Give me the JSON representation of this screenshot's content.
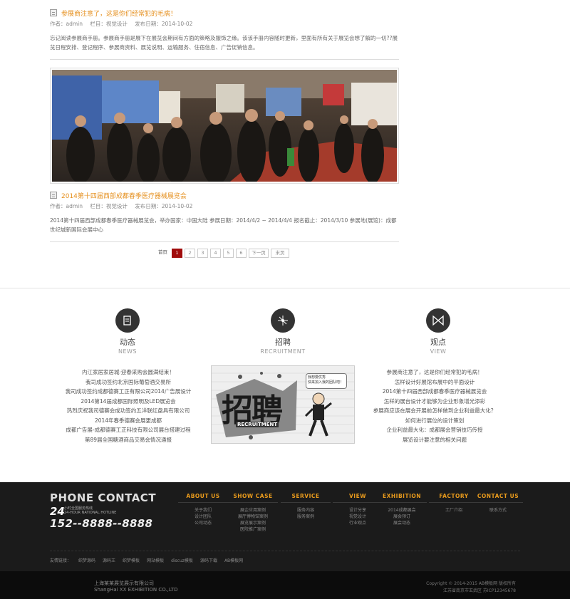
{
  "articles": [
    {
      "title": "参展商注意了，这是你们经常犯的毛病！",
      "author": "作者：admin",
      "column": "栏目：视觉设计",
      "date": "发布日期：2014-10-02",
      "summary": "忘记阅读参展商手册。参展商手册是展下在展览会期间有方面的策略及服饰之缘。该该手册内容随时更新，里面有所有关于展览会想了解的一切??展览日程安排、登记程序、参展商资料、展览说明、运输服务、住宿信息、广告促销信息。"
    },
    {
      "title": "2014第十四届西部成都春季医疗器械展览会",
      "author": "作者：admin",
      "column": "栏目：视觉设计",
      "date": "发布日期：2014-10-02",
      "summary": "2014第十四届西部成都春季医疗器械展览会，举办国家：中国大陆 参展日期：2014/4/2 ~ 2014/4/4 报名截止：2014/3/10 参展地(展馆)：成都世纪城新国际会展中心"
    }
  ],
  "pager": {
    "first": "首页",
    "pages": [
      "1",
      "2",
      "3",
      "4",
      "5",
      "6"
    ],
    "next": "下一页",
    "last": "末页"
  },
  "columns": {
    "news": {
      "cn": "动态",
      "en": "NEWS",
      "icon": "document-icon"
    },
    "recruit": {
      "cn": "招聘",
      "en": "RECRUITMENT",
      "icon": "sparkle-icon"
    },
    "view": {
      "cn": "观点",
      "en": "VIEW",
      "icon": "bowtie-icon"
    }
  },
  "news_links": [
    "内江家居家居城·迎春采购会圆满结束！",
    "我司成功签约北京国际葡萄酒交易所",
    "我司成功签约成都德赛工正有限公司2014广告展设计",
    "2014第14届成都国际照明及LED展览会",
    "热烈庆祝我司德赛会成功签约五洋联红盘具有限公司",
    "2014年春季德赛会展更成都",
    "成都广告展-成都德赛工正科技有限公司展台搭建过程",
    "第89届全国糖酒商品交易会情况通报"
  ],
  "recruit_image": {
    "headline": "招聘",
    "subline": "RECRUITMENT",
    "bubble1": "我想要优秀",
    "bubble2": "快来加入我的团队吧！"
  },
  "view_links": [
    "参展商注意了，这是你们经常犯的毛病！",
    "怎样设计好展馆布展中的平面设计",
    "2014第十四届西部成都春季医疗器械展览会",
    "怎样的展台设计才能够为企业形象增光添彩",
    "参展商应该在展会开展前怎样做到企业利益最大化？",
    "如何进行展位的设计策划",
    "企业利益最大化：成都展会营销技巧传授",
    "展览设计要注意的相关问题"
  ],
  "footer": {
    "phone_title": "PHONE CONTACT",
    "hotline_mark": "24",
    "hotline_cn": "小时全国服务热线",
    "hotline_en": "24-HOUR NATIONAL HOTLINE",
    "phone": "152--8888--8888",
    "cols": [
      {
        "head": "ABOUT US",
        "items": [
          "关于我们",
          "设计团队",
          "公司动态"
        ]
      },
      {
        "head": "SHOW CASE",
        "items": [
          "展企应用案例",
          "展厅博物馆案例",
          "展览展示案例",
          "医院推广案例"
        ]
      },
      {
        "head": "SERVICE",
        "items": [
          "服务内容",
          "服务案例"
        ]
      },
      {
        "head": "VIEW",
        "items": [
          "设计分享",
          "视觉设计",
          "行业观点"
        ]
      },
      {
        "head": "EXHIBITION",
        "items": [
          "2014成都展会",
          "展会预订",
          "展会动态"
        ]
      },
      {
        "head": "FACTORY",
        "items": [
          "工厂介绍"
        ]
      },
      {
        "head": "CONTACT US",
        "items": [
          "联系方式"
        ]
      }
    ],
    "friend_links": [
      "友情链接：",
      "织梦源码",
      "源码王",
      "织梦模板",
      "网站模板",
      "discuz模板",
      "源码下载",
      "AB模板网"
    ],
    "company_cn": "上海某某展览展示有限公司",
    "company_en": "ShangHai XX EXHIBITION CO.,LTD",
    "copyright": "Copyright © 2014-2015 AB模板网 版权所有",
    "address": "江苏省南京市玄武区 苏ICP12345678"
  },
  "colors": {
    "accent": "#e69223",
    "pager_active": "#a00c0c",
    "footer_bg": "#1b1b1b"
  }
}
